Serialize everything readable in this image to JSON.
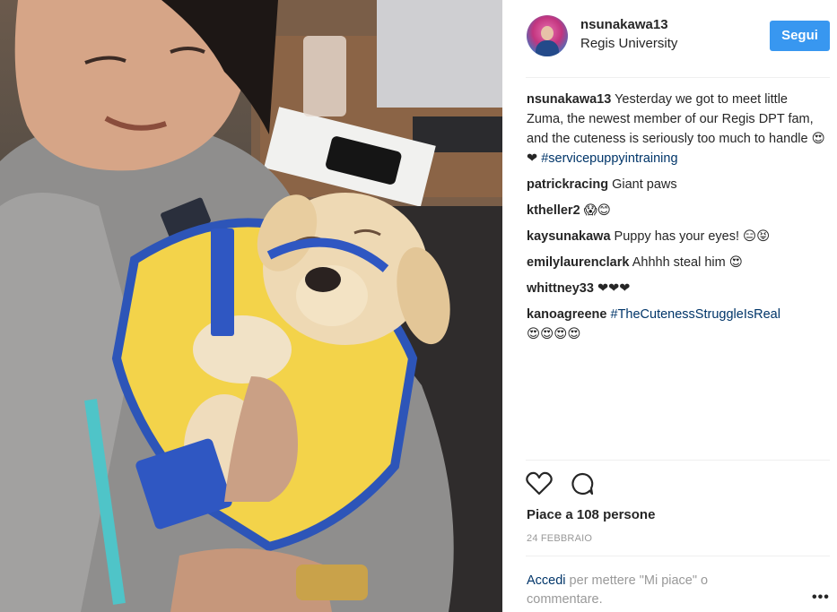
{
  "post": {
    "username": "nsunakawa13",
    "location": "Regis University",
    "follow_label": "Segui"
  },
  "comments": [
    {
      "user": "nsunakawa13",
      "text": "Yesterday we got to meet little Zuma, the newest member of our Regis DPT fam, and the cuteness is seriously too much to handle 😍❤ ",
      "tag": "#servicepuppyintraining"
    },
    {
      "user": "patrickracing",
      "text": "Giant paws",
      "tag": ""
    },
    {
      "user": "ktheller2",
      "text": "😱😊",
      "tag": ""
    },
    {
      "user": "kaysunakawa",
      "text": "Puppy has your eyes! 😑😝",
      "tag": ""
    },
    {
      "user": "emilylaurenclark",
      "text": "Ahhhh steal him 😍",
      "tag": ""
    },
    {
      "user": "whittney33",
      "text": "❤❤❤",
      "tag": ""
    },
    {
      "user": "kanoagreene",
      "text": "",
      "tag": "#TheCutenessStruggleIsReal",
      "extra": "😍😍😍😍"
    }
  ],
  "actions": {
    "like_icon": "heart-icon",
    "comment_icon": "comment-bubble-icon"
  },
  "likes_text": "Piace a 108 persone",
  "date_text": "24 FEBBRAIO",
  "login": {
    "link": "Accedi",
    "rest": " per mettere \"Mi piace\" o commentare."
  },
  "more_label": "•••",
  "colors": {
    "follow_button": "#3897f0",
    "link": "#003569",
    "muted": "#999999"
  }
}
